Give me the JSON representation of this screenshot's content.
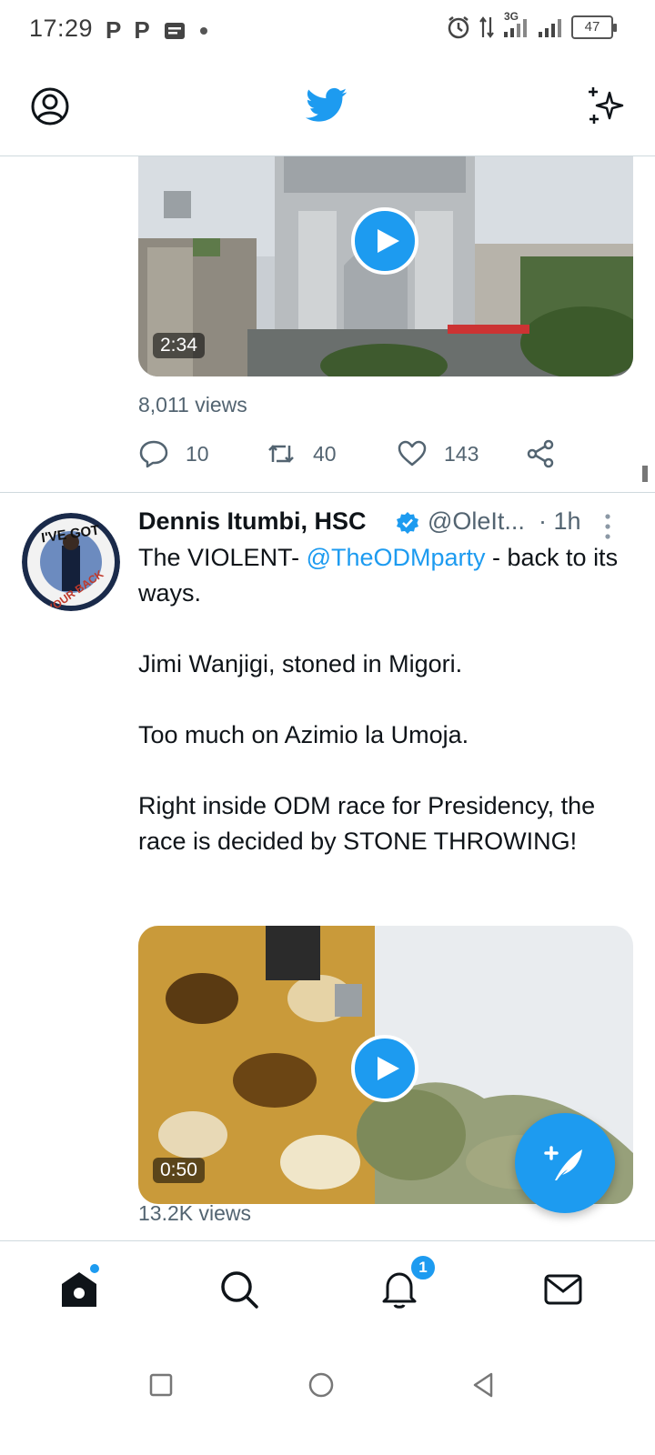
{
  "status_bar": {
    "time": "17:29",
    "left_icons": [
      "P",
      "P"
    ],
    "network": "3G",
    "battery": "47"
  },
  "header": {
    "profile_icon": "profile-icon",
    "logo": "twitter-bird-icon",
    "sparkle_icon": "sparkle-icon"
  },
  "tweet1": {
    "video_duration": "2:34",
    "views": "8,011 views",
    "replies": "10",
    "retweets": "40",
    "likes": "143"
  },
  "tweet2": {
    "author_name": "Dennis Itumbi, HSC",
    "handle": "@OleIt...",
    "time": "· 1h",
    "text_part1": "The VIOLENT- ",
    "mention": "@TheODMparty",
    "text_part2": " - back to its ways.",
    "para2": "Jimi Wanjigi, stoned in Migori.",
    "para3": "Too much on Azimio la Umoja.",
    "para4": "Right inside ODM race for Presidency, the race is decided by STONE THROWING!",
    "video_duration": "0:50",
    "views": "13.2K views",
    "avatar_text_top": "I'VE GOT",
    "avatar_text_bottom": "YOUR BACK"
  },
  "bottom_nav": {
    "items": [
      "home-icon",
      "search-icon",
      "notifications-icon",
      "messages-icon"
    ],
    "notification_count": "1"
  },
  "colors": {
    "accent": "#1d9bf0",
    "text": "#0f1419",
    "secondary_text": "#536471",
    "divider": "#cfd9de"
  }
}
